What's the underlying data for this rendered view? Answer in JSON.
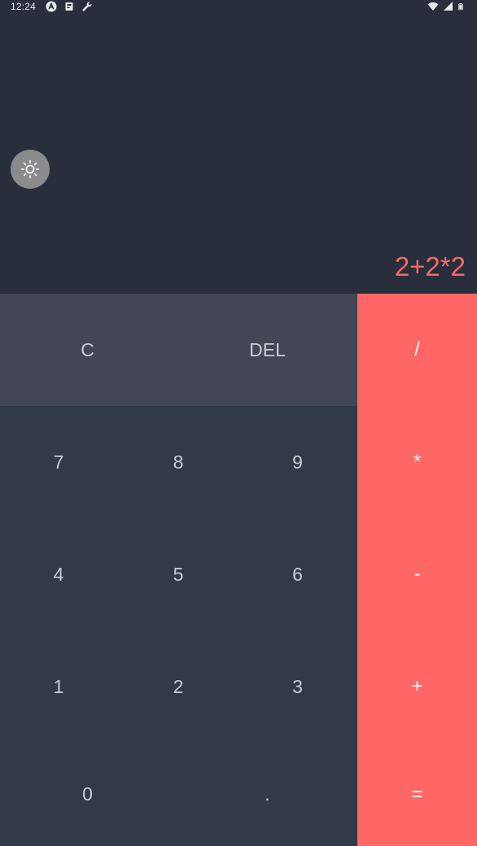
{
  "status_bar": {
    "time": "12:24",
    "left_icons": [
      "app-a-icon",
      "notification-icon",
      "wrench-icon"
    ],
    "right_icons": [
      "wifi-icon",
      "signal-icon",
      "battery-icon"
    ]
  },
  "display": {
    "expression": "2+2*2",
    "expression_color": "#ff6666",
    "theme_toggle_icon": "sun-icon"
  },
  "keypad": {
    "top_row": [
      "C",
      "DEL"
    ],
    "numbers": {
      "row1": [
        "7",
        "8",
        "9"
      ],
      "row2": [
        "4",
        "5",
        "6"
      ],
      "row3": [
        "1",
        "2",
        "3"
      ],
      "row4": [
        "0",
        "."
      ]
    },
    "operators": [
      "/",
      "*",
      "-",
      "+",
      "="
    ]
  },
  "colors": {
    "background": "#282e3b",
    "top_row": "#424753",
    "number_area": "#323a47",
    "accent": "#ff6666",
    "key_text": "#c9ccd3"
  }
}
